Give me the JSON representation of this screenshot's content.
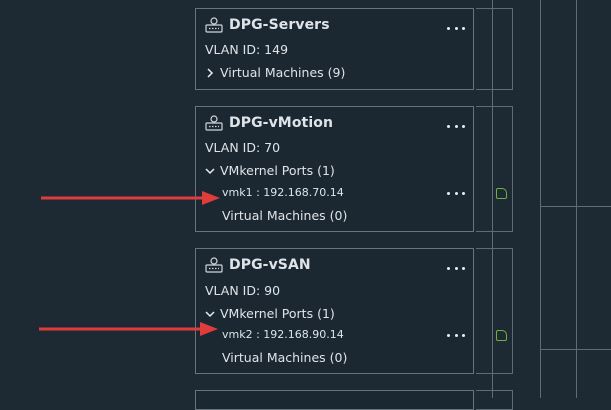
{
  "colors": {
    "background": "#1d2a34",
    "card_border": "#66747e",
    "text": "#dfe4e8",
    "arrow": "#e03c3c",
    "port_green": "#6fb13f"
  },
  "cards": [
    {
      "title": "DPG-Servers",
      "icon": "port-group-icon",
      "vlan": "VLAN ID: 149",
      "vm_section": "Virtual Machines (9)",
      "vm_expanded": false
    },
    {
      "title": "DPG-vMotion",
      "icon": "port-group-icon",
      "vlan": "VLAN ID: 70",
      "vmkernel_section": "VMkernel Ports (1)",
      "vmkernel_expanded": true,
      "port": "vmk1 : 192.168.70.14",
      "vm_section": "Virtual Machines (0)"
    },
    {
      "title": "DPG-vSAN",
      "icon": "port-group-icon",
      "vlan": "VLAN ID: 90",
      "vmkernel_section": "VMkernel Ports (1)",
      "vmkernel_expanded": true,
      "port": "vmk2 : 192.168.90.14",
      "vm_section": "Virtual Machines (0)"
    }
  ],
  "annotations": [
    {
      "type": "arrow",
      "points_to": "vmk1",
      "color": "#e03c3c"
    },
    {
      "type": "arrow",
      "points_to": "vmk2",
      "color": "#e03c3c"
    }
  ]
}
